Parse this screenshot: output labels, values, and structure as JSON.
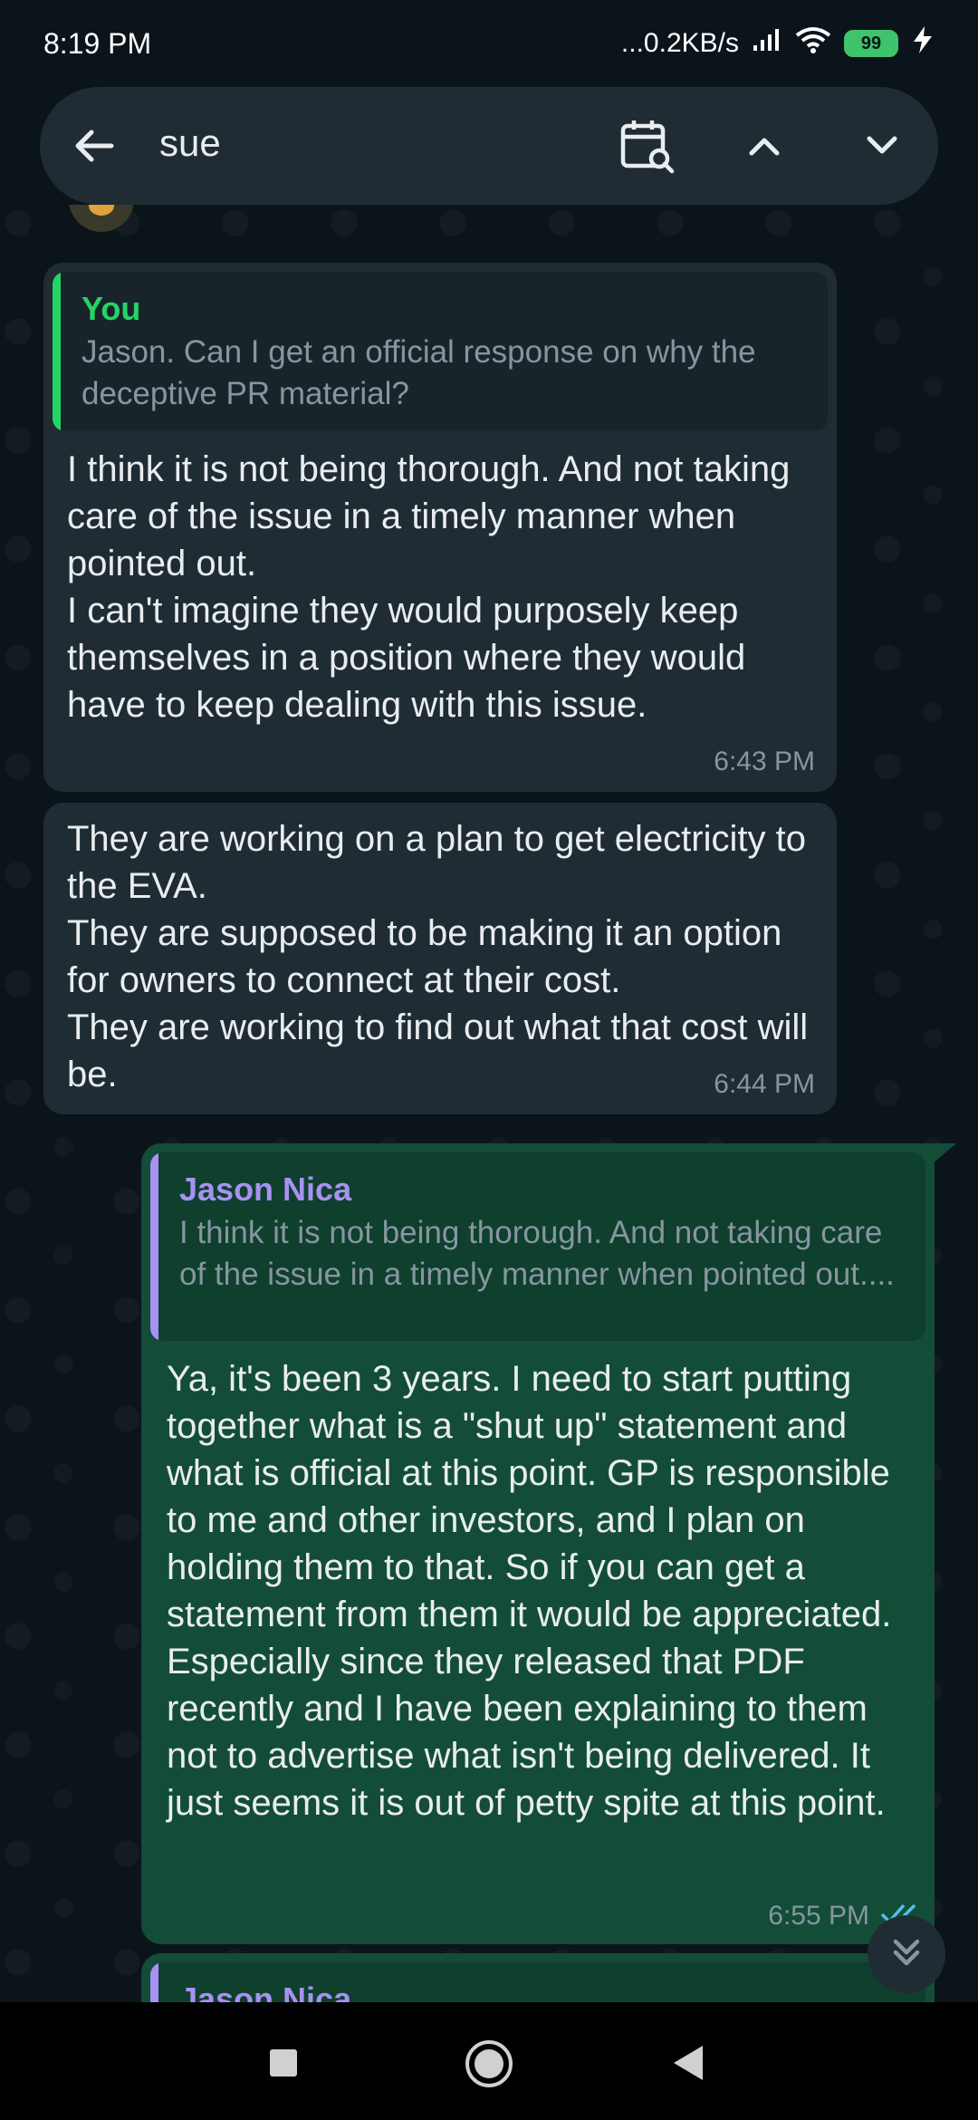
{
  "status_bar": {
    "time": "8:19 PM",
    "network_speed": "...0.2KB/s",
    "battery_level": "99"
  },
  "search_bar": {
    "query": "sue",
    "icons": [
      "back-arrow-icon",
      "calendar-search-icon",
      "chevron-up-icon",
      "chevron-down-icon"
    ]
  },
  "messages": [
    {
      "direction": "incoming",
      "quote": {
        "author": "You",
        "text": "Jason. Can I get an official response on why the deceptive PR material?"
      },
      "text": "I think it is not being thorough. And not taking care of the issue in a timely manner when pointed out.\nI can't imagine they would purposely keep themselves in a position where they would have to keep dealing with this issue.",
      "time": "6:43 PM"
    },
    {
      "direction": "incoming",
      "text": "They are working on a plan to get electricity to the EVA.\nThey are supposed to be making it an option for owners to connect at their cost.\nThey are working to find out what that cost will be.",
      "time": "6:44 PM"
    },
    {
      "direction": "outgoing",
      "quote": {
        "author": "Jason Nica",
        "text": "I think it is not being thorough. And not taking care of the issue in a timely manner when pointed out...."
      },
      "text": "Ya, it's been 3 years. I need to start putting together what is a \"shut up\" statement and what is official at this point. GP is responsible to me and other investors, and I plan on holding them to that. So if you can get a statement from them it would be appreciated. Especially since they released that PDF recently and I have been explaining to them not to advertise what isn't being delivered. It just seems it is out of petty spite at this point.",
      "time": "6:55 PM",
      "status": "read"
    },
    {
      "direction": "outgoing",
      "quote": {
        "author": "Jason Nica"
      }
    }
  ],
  "colors": {
    "background": "#0b141a",
    "incoming_bubble": "#1f2c34",
    "outgoing_bubble": "#134d37",
    "quote_you": "#25d366",
    "quote_other": "#a791f2",
    "read_ticks": "#53bdeb"
  }
}
